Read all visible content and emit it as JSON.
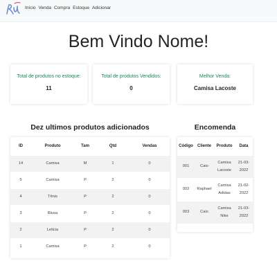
{
  "nav": {
    "logo_text": "RU",
    "links": [
      "Início",
      "Venda",
      "Compra",
      "Estoque",
      "Adicionar"
    ]
  },
  "welcome": {
    "prefix": "Bem Vindo ",
    "name": "Nome",
    "suffix": "!"
  },
  "stats": [
    {
      "label": "Total de produtos no estoque:",
      "value": "11"
    },
    {
      "label": "Total de produtos Vendidos:",
      "value": "0"
    },
    {
      "label": "Melhor Venda:",
      "value": "Camisa Lacoste"
    }
  ],
  "products": {
    "title": "Dez ultimos produtos adicionados",
    "headers": [
      "ID",
      "Produto",
      "Tam",
      "Qtd",
      "Vendas"
    ],
    "rows": [
      [
        "14",
        "Camisa",
        "M",
        "1",
        "0"
      ],
      [
        "5",
        "Camisa",
        "P",
        "2",
        "0"
      ],
      [
        "4",
        "Tênis",
        "P",
        "2",
        "0"
      ],
      [
        "3",
        "Blusa",
        "P",
        "2",
        "0"
      ],
      [
        "2",
        "Leticia",
        "P",
        "2",
        "0"
      ],
      [
        "1",
        "Camisa",
        "P",
        "2",
        "0"
      ]
    ]
  },
  "orders": {
    "title": "Encomenda",
    "headers": [
      "Código",
      "Cliente",
      "Produto",
      "Data"
    ],
    "rows": [
      [
        "001",
        "Caio",
        "Camisa Lacoste",
        "21-03-2022"
      ],
      [
        "002",
        "Raphael",
        "Camisa Adidas",
        "21-02-2022"
      ],
      [
        "003",
        "Caio",
        "Camisa Nike",
        "21-03-2022"
      ]
    ]
  },
  "colors": {
    "stat_label": "#198754",
    "stripe": "#f2f2f2",
    "navbar_bg": "#f8f9fa"
  }
}
